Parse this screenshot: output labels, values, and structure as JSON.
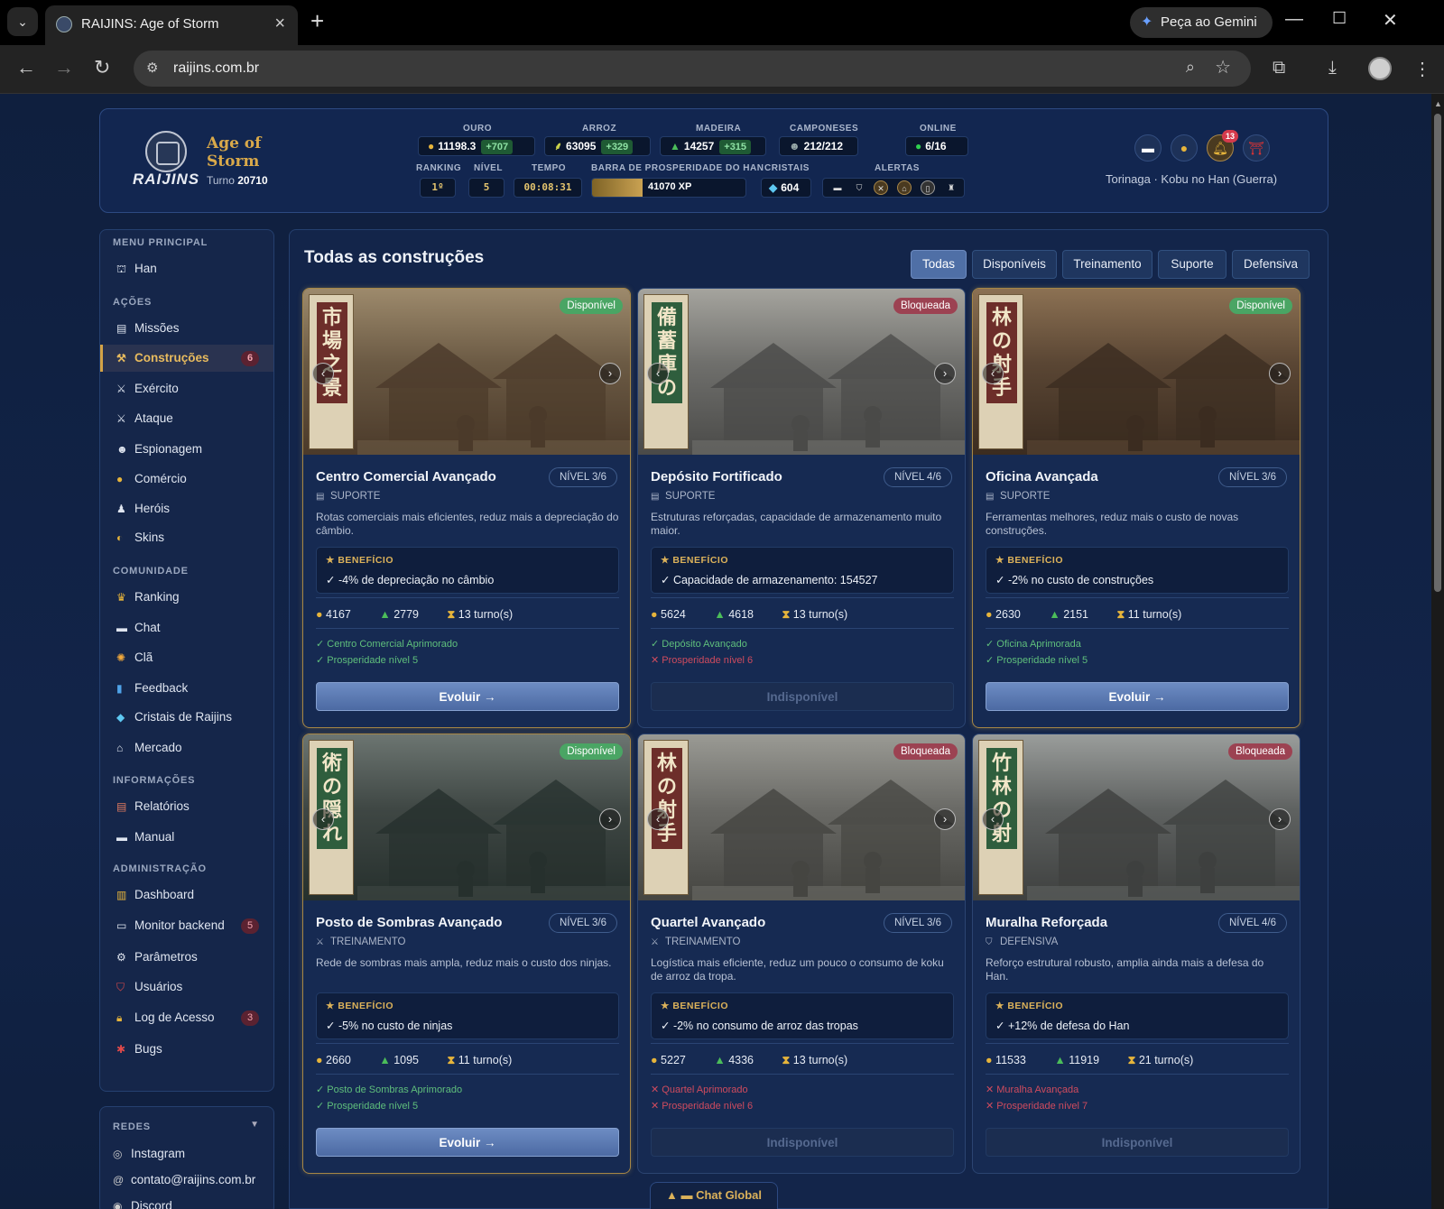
{
  "browser": {
    "tab_title": "RAIJINS: Age of Storm",
    "url": "raijins.com.br",
    "gemini_label": "Peça ao Gemini"
  },
  "header": {
    "logo_text": "RAIJINS",
    "game_title": "Age of Storm",
    "turn_label": "Turno",
    "turn_value": "20710",
    "labels": {
      "gold": "OURO",
      "rice": "ARROZ",
      "wood": "MADEIRA",
      "peasants": "CAMPONESES",
      "online": "ONLINE",
      "ranking": "RANKING",
      "level": "NÍVEL",
      "time": "TEMPO",
      "prosperity": "BARRA DE PROSPERIDADE DO HAN",
      "crystals": "CRISTAIS",
      "alerts": "ALERTAS"
    },
    "gold": "11198.3",
    "gold_delta": "+707",
    "rice": "63095",
    "rice_delta": "+329",
    "wood": "14257",
    "wood_delta": "+315",
    "peasants": "212/212",
    "online": "6/16",
    "ranking": "1º",
    "level": "5",
    "time": "00:08:31",
    "prosperity_xp": "41070 XP",
    "prosperity_fill": 0.33,
    "crystals": "604",
    "notif_count": "13",
    "player": "Torinaga · Kobu no Han (Guerra)"
  },
  "sidebar": {
    "sections": {
      "main": "MENU PRINCIPAL",
      "actions": "AÇÕES",
      "community": "COMUNIDADE",
      "info": "INFORMAÇÕES",
      "admin": "ADMINISTRAÇÃO"
    },
    "items": {
      "han": "Han",
      "missions": "Missões",
      "buildings": "Construções",
      "buildings_badge": "6",
      "army": "Exército",
      "attack": "Ataque",
      "espionage": "Espionagem",
      "commerce": "Comércio",
      "heroes": "Heróis",
      "skins": "Skins",
      "ranking": "Ranking",
      "chat": "Chat",
      "clan": "Clã",
      "feedback": "Feedback",
      "crystals": "Cristais de Raijins",
      "market": "Mercado",
      "reports": "Relatórios",
      "manual": "Manual",
      "dashboard": "Dashboard",
      "monitor": "Monitor backend",
      "monitor_badge": "5",
      "params": "Parâmetros",
      "users": "Usuários",
      "access_log": "Log de Acesso",
      "access_log_badge": "3",
      "bugs": "Bugs"
    },
    "redes": {
      "title": "REDES",
      "instagram": "Instagram",
      "email": "contato@raijins.com.br",
      "discord": "Discord"
    }
  },
  "main": {
    "title": "Todas as construções",
    "filters": [
      "Todas",
      "Disponíveis",
      "Treinamento",
      "Suporte",
      "Defensiva"
    ],
    "benefit_label": "BENEFÍCIO",
    "cards": [
      {
        "name": "Centro Comercial Avançado",
        "level": "NÍVEL 3/6",
        "category": "SUPORTE",
        "status": "Disponível",
        "desc": "Rotas comerciais mais eficientes, reduz mais a depreciação do câmbio.",
        "benefit": "✓ -4% de depreciação no câmbio",
        "gold": "4167",
        "wood": "2779",
        "turns": "13 turno(s)",
        "req1": "✓ Centro Comercial Aprimorado",
        "req2": "✓ Prosperidade nível 5",
        "button": "Evoluir →",
        "kanji": "市場之景"
      },
      {
        "name": "Depósito Fortificado",
        "level": "NÍVEL 4/6",
        "category": "SUPORTE",
        "status": "Bloqueada",
        "desc": "Estruturas reforçadas, capacidade de armazenamento muito maior.",
        "benefit": "✓ Capacidade de armazenamento: 154527",
        "gold": "5624",
        "wood": "4618",
        "turns": "13 turno(s)",
        "req1": "✓ Depósito Avançado",
        "req2": "✕ Prosperidade nível 6",
        "button": "Indisponível",
        "kanji": "備蓄庫の管理"
      },
      {
        "name": "Oficina Avançada",
        "level": "NÍVEL 3/6",
        "category": "SUPORTE",
        "status": "Disponível",
        "desc": "Ferramentas melhores, reduz mais o custo de novas construções.",
        "benefit": "✓ -2% no custo de construções",
        "gold": "2630",
        "wood": "2151",
        "turns": "11 turno(s)",
        "req1": "✓ Oficina Aprimorada",
        "req2": "✓ Prosperidade nível 5",
        "button": "Evoluir →",
        "kanji": "林の射手"
      },
      {
        "name": "Posto de Sombras Avançado",
        "level": "NÍVEL 3/6",
        "category": "TREINAMENTO",
        "status": "Disponível",
        "desc": "Rede de sombras mais ampla, reduz mais o custo dos ninjas.",
        "benefit": "✓ -5% no custo de ninjas",
        "gold": "2660",
        "wood": "1095",
        "turns": "11 turno(s)",
        "req1": "✓ Posto de Sombras Aprimorado",
        "req2": "✓ Prosperidade nível 5",
        "button": "Evoluir →",
        "kanji": "術の隠れ里"
      },
      {
        "name": "Quartel Avançado",
        "level": "NÍVEL 3/6",
        "category": "TREINAMENTO",
        "status": "Bloqueada",
        "desc": "Logística mais eficiente, reduz um pouco o consumo de koku de arroz da tropa.",
        "benefit": "✓ -2% no consumo de arroz das tropas",
        "gold": "5227",
        "wood": "4336",
        "turns": "13 turno(s)",
        "req1": "✕ Quartel Aprimorado",
        "req2": "✕ Prosperidade nível 6",
        "button": "Indisponível",
        "kanji": "林の射手"
      },
      {
        "name": "Muralha Reforçada",
        "level": "NÍVEL 4/6",
        "category": "DEFENSIVA",
        "status": "Bloqueada",
        "desc": "Reforço estrutural robusto, amplia ainda mais a defesa do Han.",
        "benefit": "✓ +12% de defesa do Han",
        "gold": "11533",
        "wood": "11919",
        "turns": "21 turno(s)",
        "req1": "✕ Muralha Avançada",
        "req2": "✕ Prosperidade nível 7",
        "button": "Indisponível",
        "kanji": "竹林の射"
      }
    ]
  },
  "chat_global": "Chat Global",
  "colors": {
    "accent_gold": "#d4a346",
    "available": "#4aa564",
    "locked": "#9c4252",
    "bg": "#0f1f3d"
  }
}
